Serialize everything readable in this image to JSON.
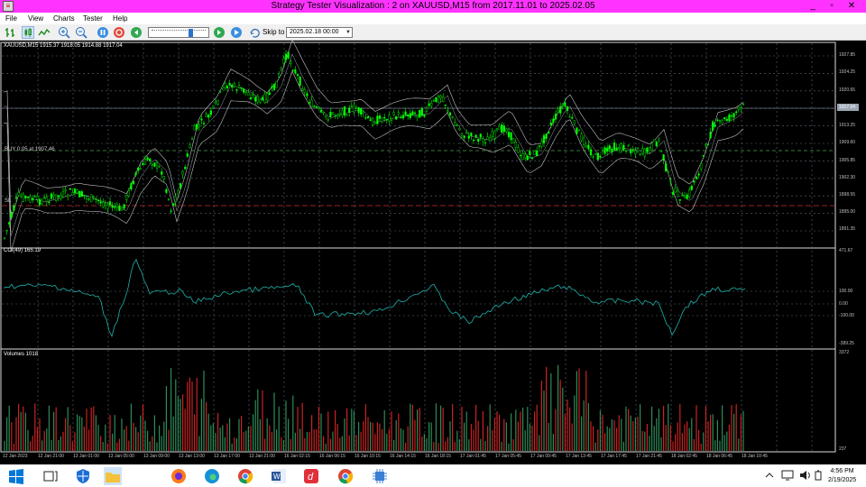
{
  "window": {
    "title": "Strategy Tester Visualization : 2 on XAUUSD,M15 from 2017.11.01 to 2025.02.05",
    "minimize": "_",
    "maximize": "▫",
    "close": "✕"
  },
  "menu": {
    "items": [
      "File",
      "View",
      "Charts",
      "Tester",
      "Help"
    ]
  },
  "toolbar": {
    "skip_label": "Skip to",
    "skip_date": "2025.02.18 00:00",
    "icons": [
      "bar-chart-icon",
      "candles-icon",
      "line-chart-icon",
      "zoom-in-icon",
      "zoom-out-icon",
      "pause-icon",
      "stop-icon",
      "step-back-icon",
      "step-forward-icon",
      "play-icon"
    ]
  },
  "chart": {
    "header": "XAUUSD,M15  1915.37 1918.05 1914.88 1917.04",
    "buy_label": "BUY 0.05 at 1907.46",
    "sl_label": "SL",
    "cci_label": "CCI(49) 165.19",
    "volume_label": "Volumes 1018",
    "current_price": "1917.04",
    "price_axis": [
      "1927.85",
      "1924.25",
      "1920.65",
      "1917.04",
      "1913.25",
      "1909.60",
      "1905.85",
      "1902.30",
      "1898.55",
      "1895.00",
      "1891.35"
    ],
    "cci_axis": [
      "471.67",
      "100.00",
      "0.00",
      "-100.00",
      "-389.25"
    ],
    "volume_axis": [
      "3372",
      "237"
    ],
    "time_axis": [
      "12 Jan 2023",
      "12 Jan 21:00",
      "13 Jan 01:00",
      "13 Jan 05:00",
      "13 Jan 09:00",
      "13 Jan 13:00",
      "13 Jan 17:00",
      "13 Jan 21:00",
      "16 Jan 02:15",
      "16 Jan 06:15",
      "16 Jan 10:15",
      "16 Jan 14:15",
      "16 Jan 18:15",
      "17 Jan 01:45",
      "17 Jan 05:45",
      "17 Jan 09:45",
      "17 Jan 13:45",
      "17 Jan 17:45",
      "17 Jan 21:45",
      "18 Jan 02:45",
      "18 Jan 06:45",
      "18 Jan 10:45"
    ],
    "colors": {
      "bull": "#00ff00",
      "bear": "#00ff00",
      "cci": "#20b2aa",
      "vol_up": "#2e8b57",
      "vol_down": "#cc2222",
      "grid": "#5a6a7a"
    }
  },
  "taskbar": {
    "icons": [
      "windows-start-icon",
      "search-icon",
      "task-view-icon",
      "security-shield-icon",
      "file-explorer-icon",
      "firefox-icon",
      "edge-icon",
      "chrome-icon",
      "word-icon",
      "app-d-icon",
      "metatrader-icon",
      "chrome-profile-icon",
      "chip-icon"
    ],
    "time": "4:56 PM",
    "date": "2/19/2025"
  }
}
